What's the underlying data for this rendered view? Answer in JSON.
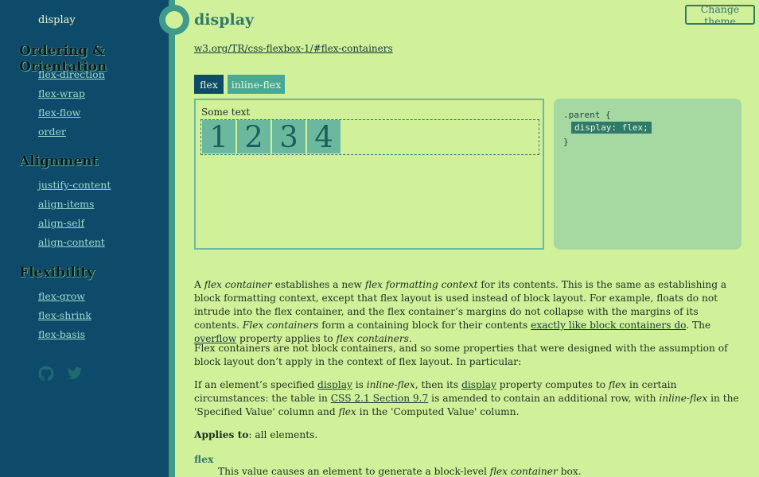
{
  "sidebar": {
    "top_item": "display",
    "sections": [
      {
        "title": "Ordering & Orientation",
        "links": [
          "flex-direction",
          "flex-wrap",
          "flex-flow",
          "order"
        ]
      },
      {
        "title": "Alignment",
        "links": [
          "justify-content",
          "align-items",
          "align-self",
          "align-content"
        ]
      },
      {
        "title": "Flexibility",
        "links": [
          "flex-grow",
          "flex-shrink",
          "flex-basis"
        ]
      }
    ],
    "social_icons": [
      "github-icon",
      "twitter-icon"
    ]
  },
  "main": {
    "title": "display",
    "spec_link": "w3.org/TR/css-flexbox-1/#flex-containers",
    "theme_button": "Change theme",
    "tabs": [
      "flex",
      "inline-flex"
    ],
    "active_tab": "flex",
    "demo": {
      "label": "Some text",
      "items": [
        "1",
        "2",
        "3",
        "4"
      ]
    },
    "code": {
      "open": ".parent {",
      "rule": "display: flex;",
      "close": "}"
    },
    "paragraphs": {
      "p1": {
        "a": "A ",
        "b": "flex container",
        "c": " establishes a new ",
        "d": "flex formatting context",
        "e": " for its contents. This is the same as establishing a block formatting context, except that flex layout is used instead of block layout. For example, floats do not intrude into the flex container, and the flex container’s margins do not collapse with the margins of its contents. ",
        "f": "Flex containers",
        "g": " form a containing block for their contents ",
        "link1": "exactly like block containers do",
        "h": ". The ",
        "link2": "overflow",
        "i": " property applies to ",
        "j": "flex containers",
        "k": "."
      },
      "p2": "Flex containers are not block containers, and so some properties that were designed with the assumption of block layout don’t apply in the context of flex layout. In particular:",
      "p3": {
        "a": "If an element’s specified ",
        "link1": "display",
        "b": " is ",
        "c": "inline-flex",
        "d": ", then its ",
        "link2": "display",
        "e": " property computes to ",
        "f": "flex",
        "g": " in certain circumstances: the table in ",
        "link3": "CSS 2.1 Section 9.7",
        "h": " is amended to contain an additional row, with ",
        "i": "inline-flex",
        "j": " in the 'Specified Value' column and ",
        "k": "flex",
        "l": " in the 'Computed Value' column."
      },
      "p4": {
        "label": "Applies to",
        "text": ": all elements."
      }
    },
    "definition": {
      "term": "flex",
      "desc_a": "This value causes an element to generate a block-level ",
      "desc_b": "flex container",
      "desc_c": " box."
    }
  },
  "colors": {
    "sidebar_bg": "#0e4a6a",
    "accent": "#2f7a6a",
    "page_bg": "#d1f09a"
  }
}
